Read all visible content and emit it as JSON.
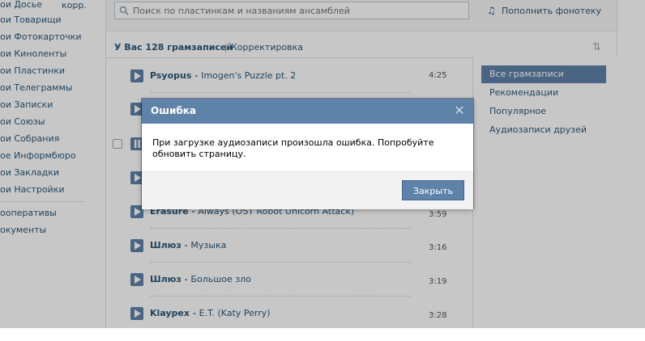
{
  "sidebar": {
    "corp_label": "корр.",
    "items": [
      {
        "label": "ои Досье"
      },
      {
        "label": "ои Товарищи"
      },
      {
        "label": "ои Фотокарточки"
      },
      {
        "label": "ои Киноленты"
      },
      {
        "label": "ои Пластинки"
      },
      {
        "label": "ои Телеграммы"
      },
      {
        "label": "ои Записки"
      },
      {
        "label": "ои Союзы"
      },
      {
        "label": "ои Собрания"
      },
      {
        "label": "ое Информбюро"
      },
      {
        "label": "ои Закладки"
      },
      {
        "label": "ои Настройки"
      },
      {
        "label": "ооперативы"
      },
      {
        "label": "окументы"
      }
    ]
  },
  "search": {
    "placeholder": "Поиск по пластинкам и названиям ансамблей"
  },
  "add_link": {
    "label": "Пополнить фонотеку",
    "icon": "music-note-icon"
  },
  "summary": {
    "count_label": "У Вас 128 грамзаписей",
    "separator": "|",
    "edit_label": "Корректировка",
    "sort_icon": "sort-arrows-icon"
  },
  "tracks": [
    {
      "artist": "Psyopus",
      "separator": "-",
      "title": "Imogen's Puzzle pt. 2",
      "duration": "4:25"
    },
    {
      "artist": "",
      "separator": "",
      "title": "",
      "duration": ""
    },
    {
      "artist": "",
      "separator": "",
      "title": "",
      "duration": ""
    },
    {
      "artist": "",
      "separator": "",
      "title": "",
      "duration": ""
    },
    {
      "artist": "Erasure",
      "separator": "-",
      "title": "Always (OST Robot Unicorn Attack)",
      "duration": "3:59"
    },
    {
      "artist": "Шлюз",
      "separator": "-",
      "title": "Музыка",
      "duration": "3:16"
    },
    {
      "artist": "Шлюз",
      "separator": "-",
      "title": "Большое зло",
      "duration": "3:19"
    },
    {
      "artist": "Klaypex",
      "separator": "-",
      "title": "E.T. (Katy Perry)",
      "duration": "3:28"
    }
  ],
  "filters": {
    "items": [
      {
        "label": "Все грамзаписи",
        "active": true
      },
      {
        "label": "Рекомендации",
        "active": false
      },
      {
        "label": "Популярное",
        "active": false
      },
      {
        "label": "Аудиозаписи друзей",
        "active": false
      }
    ]
  },
  "dialog": {
    "title": "Ошибка",
    "message": "При загрузке аудиозаписи произошла ошибка. Попробуйте обновить страницу.",
    "button_label": "Закрыть"
  },
  "colors": {
    "accent": "#5E82A8",
    "link": "#2B587A",
    "dialog_header": "#5E82A8",
    "active_filter": "#5E82A8"
  }
}
